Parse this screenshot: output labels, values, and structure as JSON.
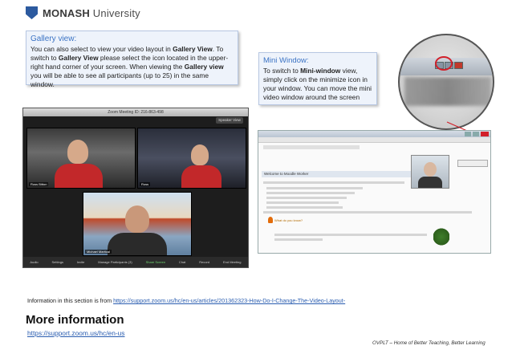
{
  "header": {
    "logo_text": "MONASH University",
    "logo_bold": "MONASH",
    "logo_rest": " University",
    "crest_icon": "monash-crest-icon"
  },
  "gallery_callout": {
    "title": "Gallery view:",
    "text_1": "You can also select to view your video layout in ",
    "bold_1": "Gallery View",
    "text_2": ". To switch to ",
    "bold_2": "Gallery View",
    "text_3": " please select the icon located in the upper-right hand corner of your screen. When viewing the ",
    "bold_3": "Gallery view",
    "text_4": " you will be able to see all participants (up to 25) in the same window."
  },
  "mini_callout": {
    "title": "Mini Window:",
    "text_1": "To switch to ",
    "bold_1": "Mini-window",
    "text_2": " view, simply click on the minimize icon in your window. You can move the mini video window around the screen"
  },
  "zoom_screenshot": {
    "window_title": "Zoom Meeting ID: 216-863-498",
    "speaker_view_button": "Speaker View",
    "participants": [
      "Russ Bitton",
      "Russ",
      "Michael Martical"
    ],
    "toolbar": [
      "Audio",
      "Settings",
      "Invite",
      "Manage Participants (3)",
      "Share Screen",
      "Chat",
      "Record",
      "End Meeting"
    ]
  },
  "moodle_screenshot": {
    "welcome_text": "Welcome to Moodle Worker",
    "what_next": "What do you know?"
  },
  "source": {
    "prefix": "Information in this section is from ",
    "url": "https://support.zoom.us/hc/en-us/articles/201362323-How-Do-I-Change-The-Video-Layout-"
  },
  "more_info": {
    "heading": "More information",
    "link": "https://support.zoom.us/hc/en-us"
  },
  "footer": {
    "note": "OVPLT – Home of Better Teaching, Better Learning"
  },
  "colors": {
    "callout_title": "#3b73c4",
    "link": "#2a5db0",
    "highlight_ring": "#d2202a"
  }
}
